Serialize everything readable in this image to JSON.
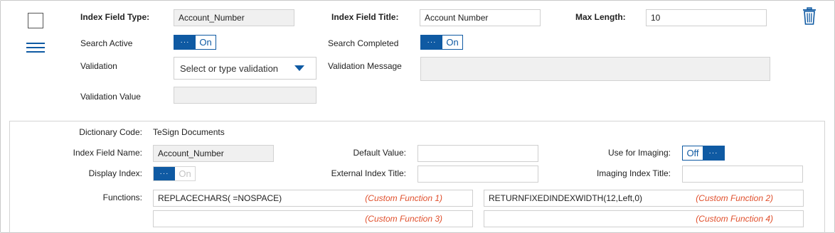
{
  "header": {
    "index_field_type_label": "Index Field Type:",
    "index_field_type_value": "Account_Number",
    "index_field_title_label": "Index Field Title:",
    "index_field_title_value": "Account Number",
    "max_length_label": "Max Length:",
    "max_length_value": "10"
  },
  "search": {
    "search_active_label": "Search Active",
    "search_active_state": "On",
    "search_completed_label": "Search Completed",
    "search_completed_state": "On"
  },
  "validation": {
    "validation_label": "Validation",
    "validation_placeholder": "Select or type validation",
    "validation_message_label": "Validation Message",
    "validation_message_value": "",
    "validation_value_label": "Validation Value",
    "validation_value_value": ""
  },
  "dictionary": {
    "dictionary_code_label": "Dictionary Code:",
    "dictionary_code_value": "TeSign Documents",
    "index_field_name_label": "Index Field Name:",
    "index_field_name_value": "Account_Number",
    "default_value_label": "Default Value:",
    "default_value_value": "",
    "use_for_imaging_label": "Use for Imaging:",
    "use_for_imaging_state": "Off",
    "display_index_label": "Display Index:",
    "display_index_state": "On",
    "external_index_title_label": "External Index Title:",
    "external_index_title_value": "",
    "imaging_index_title_label": "Imaging Index Title:",
    "imaging_index_title_value": ""
  },
  "functions": {
    "label": "Functions:",
    "items": [
      {
        "value": "REPLACECHARS( =NOSPACE)",
        "custom": "(Custom Function 1)"
      },
      {
        "value": "RETURNFIXEDINDEXWIDTH(12,Left,0)",
        "custom": "(Custom Function 2)"
      },
      {
        "value": "",
        "custom": "(Custom Function 3)"
      },
      {
        "value": "",
        "custom": "(Custom Function 4)"
      }
    ]
  },
  "toggle_knob_glyph": "···",
  "colors": {
    "accent": "#0f5aa3",
    "custom_function": "#e0502d",
    "readonly_bg": "#f0f0f0"
  },
  "icons": {
    "drag_handle": "hamburger-icon",
    "delete": "trash-icon"
  }
}
